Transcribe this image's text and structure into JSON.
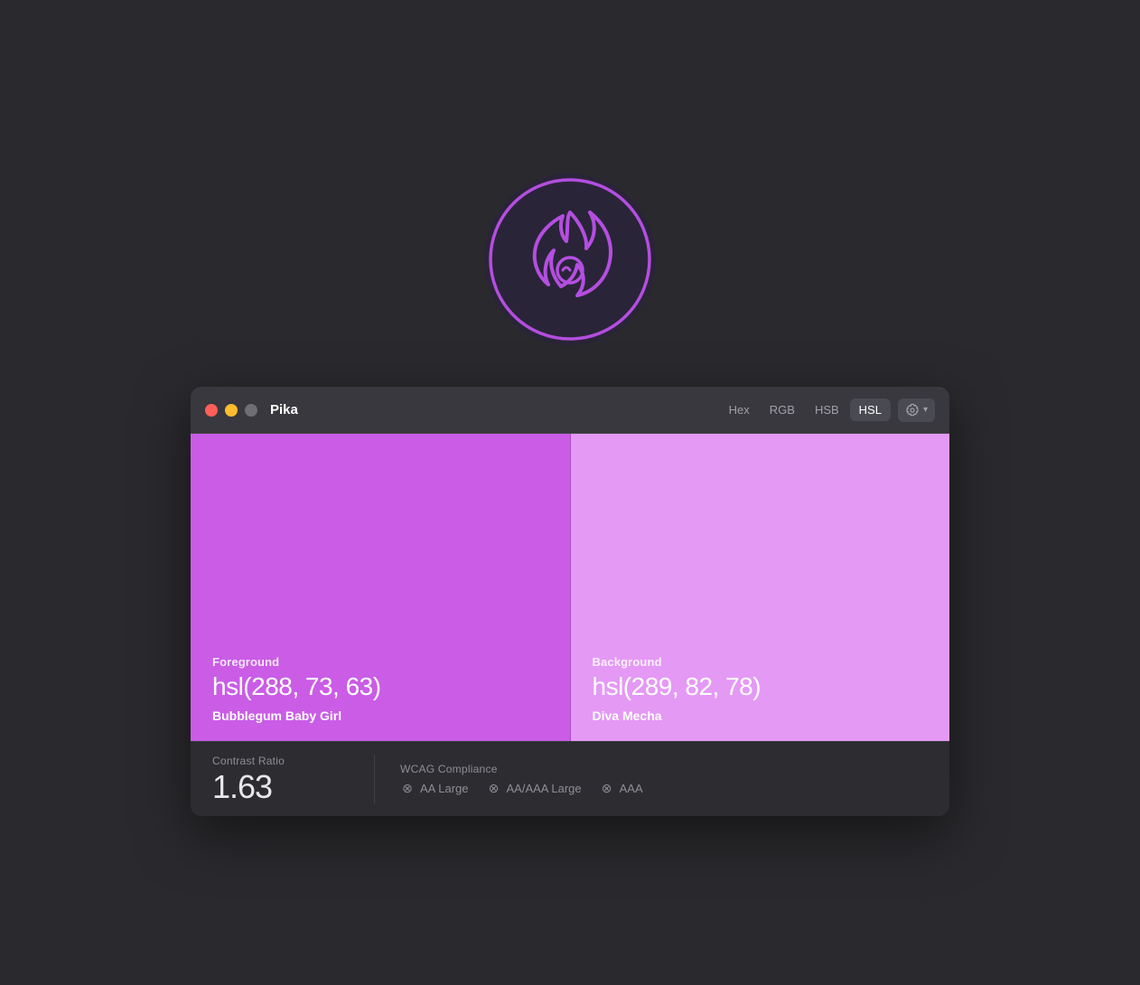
{
  "app": {
    "icon_label": "Pika app icon"
  },
  "titlebar": {
    "title": "Pika",
    "traffic_lights": {
      "red": "close",
      "yellow": "minimize",
      "gray": "fullscreen"
    },
    "format_tabs": [
      {
        "id": "hex",
        "label": "Hex",
        "active": false
      },
      {
        "id": "rgb",
        "label": "RGB",
        "active": false
      },
      {
        "id": "hsb",
        "label": "HSB",
        "active": false
      },
      {
        "id": "hsl",
        "label": "HSL",
        "active": true
      }
    ],
    "settings_label": "Settings"
  },
  "foreground": {
    "section_label": "Foreground",
    "color_value": "hsl(288, 73, 63)",
    "color_name": "Bubblegum Baby Girl",
    "hsl": "hsl(288, 73%, 63%)"
  },
  "background": {
    "section_label": "Background",
    "color_value": "hsl(289, 82, 78)",
    "color_name": "Diva Mecha",
    "hsl": "hsl(289, 82%, 78%)"
  },
  "contrast": {
    "label": "Contrast Ratio",
    "value": "1.63"
  },
  "wcag": {
    "label": "WCAG Compliance",
    "items": [
      {
        "id": "aa-large",
        "label": "AA Large",
        "pass": false
      },
      {
        "id": "aa-aaa-large",
        "label": "AA/AAA Large",
        "pass": false
      },
      {
        "id": "aaa",
        "label": "AAA",
        "pass": false
      }
    ]
  }
}
